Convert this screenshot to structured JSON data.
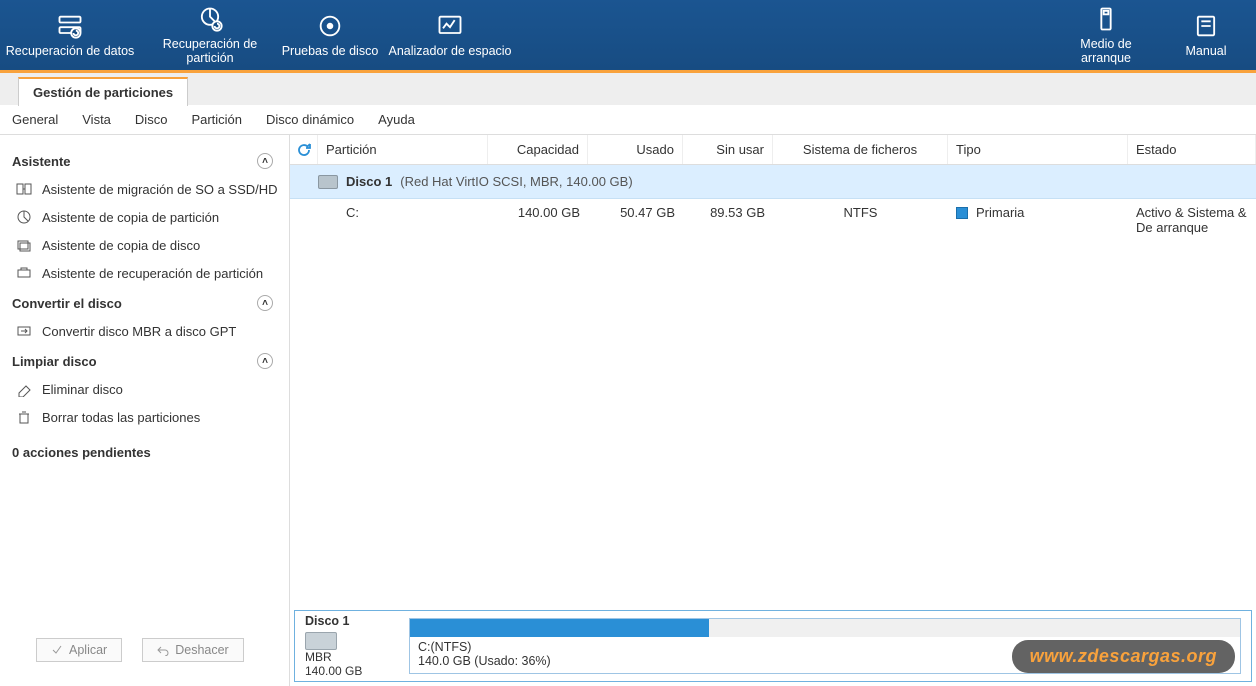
{
  "topbar": {
    "left": [
      {
        "label": "Recuperación de datos",
        "icon": "data-recovery"
      },
      {
        "label": "Recuperación de partición",
        "icon": "partition-recovery"
      },
      {
        "label": "Pruebas de disco",
        "icon": "disk-tests"
      },
      {
        "label": "Analizador de espacio",
        "icon": "space-analyzer"
      }
    ],
    "right": [
      {
        "label": "Medio de arranque",
        "icon": "boot-media"
      },
      {
        "label": "Manual",
        "icon": "manual"
      }
    ]
  },
  "tab": "Gestión de particiones",
  "menu": [
    "General",
    "Vista",
    "Disco",
    "Partición",
    "Disco dinámico",
    "Ayuda"
  ],
  "sidebar": {
    "s1": {
      "title": "Asistente",
      "items": [
        "Asistente de migración de SO a SSD/HD",
        "Asistente de copia de partición",
        "Asistente de copia de disco",
        "Asistente de recuperación de partición"
      ]
    },
    "s2": {
      "title": "Convertir el disco",
      "items": [
        "Convertir disco MBR a disco GPT"
      ]
    },
    "s3": {
      "title": "Limpiar disco",
      "items": [
        "Eliminar disco",
        "Borrar todas las particiones"
      ]
    },
    "pending": "0 acciones pendientes",
    "apply": "Aplicar",
    "undo": "Deshacer"
  },
  "table": {
    "headers": {
      "part": "Partición",
      "cap": "Capacidad",
      "used": "Usado",
      "unused": "Sin usar",
      "fs": "Sistema de ficheros",
      "type": "Tipo",
      "state": "Estado"
    },
    "disk": {
      "name": "Disco 1",
      "meta": "(Red Hat VirtIO SCSI, MBR, 140.00 GB)"
    },
    "row": {
      "part": "C:",
      "cap": "140.00 GB",
      "used": "50.47 GB",
      "unused": "89.53 GB",
      "fs": "NTFS",
      "type": "Primaria",
      "state": "Activo & Sistema & De arranque"
    }
  },
  "bottom": {
    "disk": {
      "name": "Disco 1",
      "mbr": "MBR",
      "size": "140.00 GB"
    },
    "label": "C:(NTFS)",
    "detail": "140.0 GB (Usado: 36%)",
    "fill_pct": 36
  },
  "watermark": "www.zdescargas.org"
}
